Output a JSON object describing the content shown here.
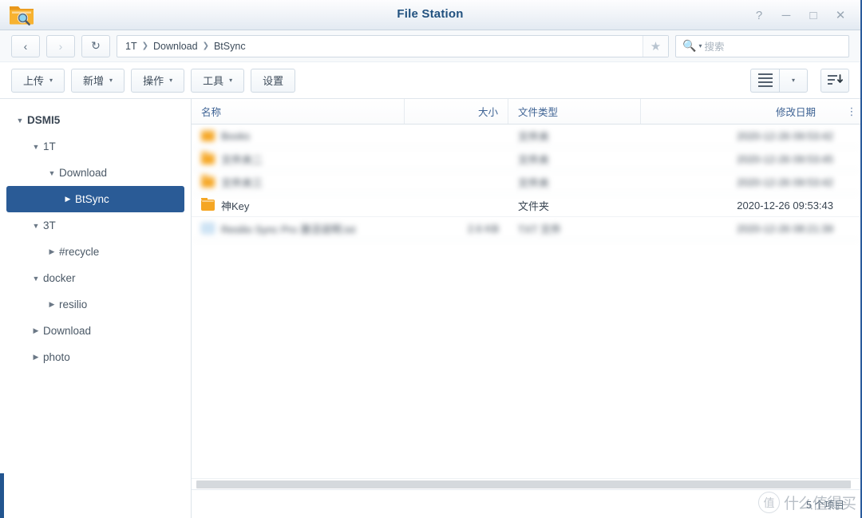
{
  "window": {
    "title": "File Station",
    "app_icon": "folder-search-icon",
    "controls": [
      {
        "name": "help-button",
        "glyph": "?"
      },
      {
        "name": "minimize-button",
        "glyph": "─"
      },
      {
        "name": "maximize-button",
        "glyph": "□"
      },
      {
        "name": "close-button",
        "glyph": "✕"
      }
    ]
  },
  "nav": {
    "back_icon": "‹",
    "forward_icon": "›",
    "refresh_icon": "↻",
    "breadcrumb": [
      "1T",
      "Download",
      "BtSync"
    ],
    "breadcrumb_separator": "❯",
    "favorite_icon": "★"
  },
  "search": {
    "placeholder": "搜索",
    "value": "",
    "icon": "search-icon"
  },
  "toolbar": {
    "buttons": [
      {
        "label": "上传",
        "caret": true
      },
      {
        "label": "新增",
        "caret": true
      },
      {
        "label": "操作",
        "caret": true
      },
      {
        "label": "工具",
        "caret": true
      },
      {
        "label": "设置",
        "caret": false
      }
    ],
    "view_mode_icon": "list-view-icon",
    "view_mode_caret": "▾",
    "sort_icon": "sort-descending-icon"
  },
  "sidebar": {
    "items": [
      {
        "label": "DSMI5",
        "depth": 0,
        "twisty": "down",
        "selected": false,
        "root": true
      },
      {
        "label": "1T",
        "depth": 1,
        "twisty": "down",
        "selected": false,
        "root": false
      },
      {
        "label": "Download",
        "depth": 2,
        "twisty": "down",
        "selected": false,
        "root": false
      },
      {
        "label": "BtSync",
        "depth": 3,
        "twisty": "right",
        "selected": true,
        "root": false
      },
      {
        "label": "3T",
        "depth": 1,
        "twisty": "down",
        "selected": false,
        "root": false
      },
      {
        "label": "#recycle",
        "depth": 2,
        "twisty": "right",
        "selected": false,
        "root": false
      },
      {
        "label": "docker",
        "depth": 1,
        "twisty": "down",
        "selected": false,
        "root": false
      },
      {
        "label": "resilio",
        "depth": 2,
        "twisty": "right",
        "selected": false,
        "root": false
      },
      {
        "label": "Download",
        "depth": 1,
        "twisty": "right",
        "selected": false,
        "root": false
      },
      {
        "label": "photo",
        "depth": 1,
        "twisty": "right",
        "selected": false,
        "root": false
      }
    ]
  },
  "filelist": {
    "columns": [
      {
        "key": "name",
        "label": "名称"
      },
      {
        "key": "size",
        "label": "大小"
      },
      {
        "key": "type",
        "label": "文件类型"
      },
      {
        "key": "date",
        "label": "修改日期"
      }
    ],
    "column_menu_icon": "⋮",
    "rows": [
      {
        "name": "Books",
        "size": "",
        "type": "文件夹",
        "date": "2020-12-26 09:53:42",
        "icon": "folder",
        "blurred": true
      },
      {
        "name": "文件夹二",
        "size": "",
        "type": "文件夹",
        "date": "2020-12-26 09:53:45",
        "icon": "folder",
        "blurred": true
      },
      {
        "name": "文件夹三",
        "size": "",
        "type": "文件夹",
        "date": "2020-12-26 09:53:42",
        "icon": "folder",
        "blurred": true
      },
      {
        "name": "神Key",
        "size": "",
        "type": "文件夹",
        "date": "2020-12-26 09:53:43",
        "icon": "folder",
        "blurred": false
      },
      {
        "name": "Resilio Sync Pro 激活说明.txt",
        "size": "2.6 KB",
        "type": "TXT 文件",
        "date": "2020-12-26 08:21:39",
        "icon": "txt",
        "blurred": true
      }
    ]
  },
  "status": {
    "text": "5 个项目"
  },
  "watermark": {
    "mark": "值",
    "text": "什么值得买"
  },
  "colors": {
    "accent": "#2a5b96",
    "title": "#21517f",
    "folder": "#f5a623",
    "header_text": "#3e6394"
  }
}
